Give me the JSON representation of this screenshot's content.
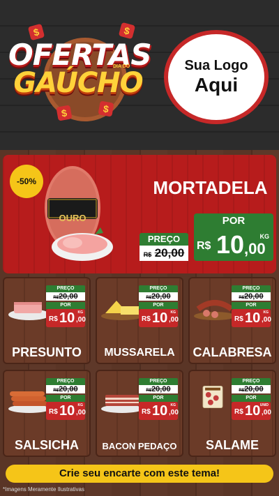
{
  "header": {
    "title_line1": "OFERTAS",
    "title_small": "DIA DO",
    "title_line2": "GAÚCHO",
    "logo_line1": "Sua Logo",
    "logo_line2": "Aqui"
  },
  "hero": {
    "badge": "-50%",
    "product_brand": "OURO",
    "product_name": "MORTADELA",
    "old_label": "PREÇO",
    "old_currency": "R$",
    "old_price": "20,00",
    "new_label": "POR",
    "new_currency": "R$",
    "new_int": "10",
    "new_cents": ",00",
    "unit": "KG"
  },
  "products": [
    {
      "name": "PRESUNTO",
      "old_label": "PREÇO",
      "old_currency": "R$",
      "old_price": "20,00",
      "new_label": "POR",
      "currency": "R$",
      "int": "10",
      "cents": ",00",
      "unit": "KG"
    },
    {
      "name": "MUSSARELA",
      "old_label": "PREÇO",
      "old_currency": "R$",
      "old_price": "20,00",
      "new_label": "POR",
      "currency": "R$",
      "int": "10",
      "cents": ",00",
      "unit": "KG"
    },
    {
      "name": "CALABRESA",
      "old_label": "PREÇO",
      "old_currency": "R$",
      "old_price": "20,00",
      "new_label": "POR",
      "currency": "R$",
      "int": "10",
      "cents": ",00",
      "unit": "KG"
    },
    {
      "name": "SALSICHA",
      "old_label": "PREÇO",
      "old_currency": "R$",
      "old_price": "20,00",
      "new_label": "POR",
      "currency": "R$",
      "int": "10",
      "cents": ",00",
      "unit": "KG"
    },
    {
      "name": "BACON PEDAÇO",
      "old_label": "PREÇO",
      "old_currency": "R$",
      "old_price": "20,00",
      "new_label": "POR",
      "currency": "R$",
      "int": "10",
      "cents": ",00",
      "unit": "KG"
    },
    {
      "name": "SALAME",
      "old_label": "PREÇO",
      "old_currency": "R$",
      "old_price": "20,00",
      "new_label": "POR",
      "currency": "R$",
      "int": "10",
      "cents": ",00",
      "unit": "UNID"
    }
  ],
  "footer": {
    "cta": "Crie seu encarte com este tema!",
    "disclaimer": "*Imagens Meramente Ilustrativas"
  },
  "colors": {
    "red": "#c62828",
    "green": "#2e7d32",
    "yellow": "#f5c518",
    "wood": "#5a3526"
  },
  "icons": [
    "dollar-coin-icon",
    "mortadela-image",
    "presunto-image",
    "mussarela-image",
    "calabresa-image",
    "salsicha-image",
    "bacon-image",
    "salame-image"
  ]
}
